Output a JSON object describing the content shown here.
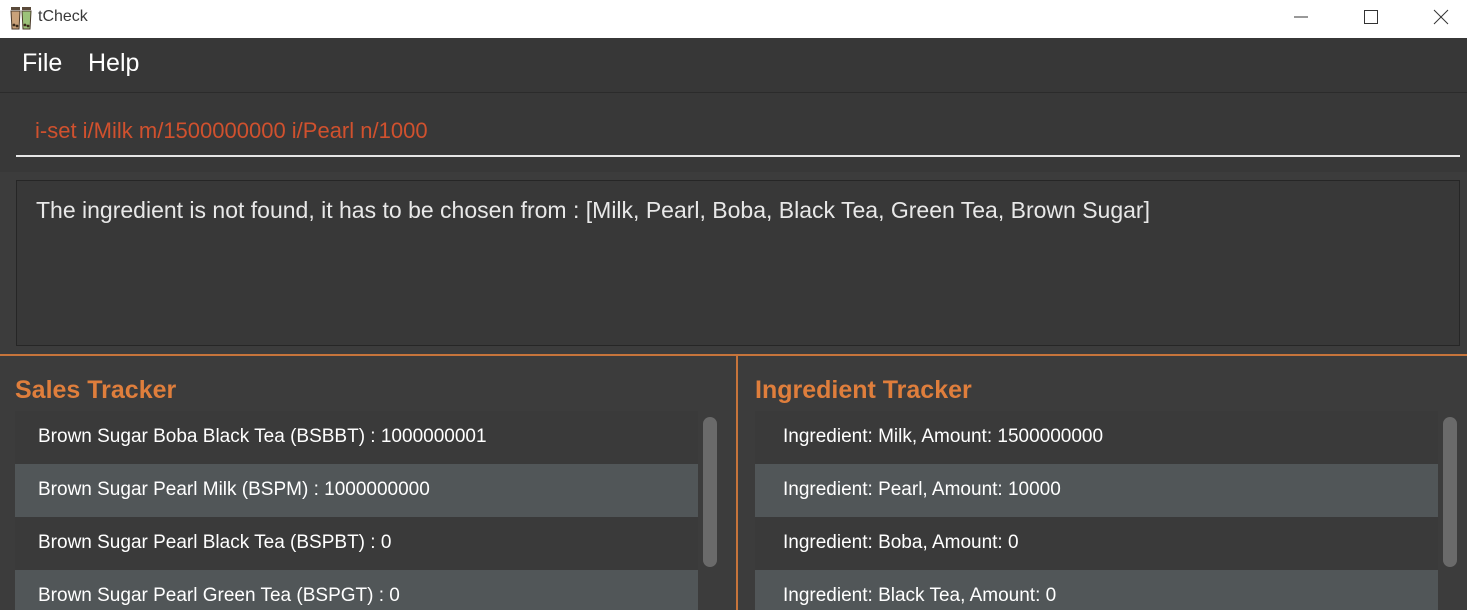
{
  "window": {
    "title": "tCheck",
    "icon": "bubble-tea-cups-icon"
  },
  "menu": {
    "file": "File",
    "help": "Help"
  },
  "command": {
    "value": "i-set i/Milk m/1500000000 i/Pearl n/1000",
    "error_color": "#d0512e"
  },
  "result": {
    "message": "The ingredient is not found, it has to be chosen from : [Milk, Pearl, Boba, Black Tea, Green Tea, Brown Sugar]"
  },
  "sales_tracker": {
    "title": "Sales Tracker",
    "items": [
      "Brown Sugar Boba Black Tea (BSBBT) : 1000000001",
      "Brown Sugar Pearl Milk (BSPM) : 1000000000",
      "Brown Sugar Pearl Black Tea (BSPBT) : 0",
      "Brown Sugar Pearl Green Tea (BSPGT) : 0"
    ]
  },
  "ingredient_tracker": {
    "title": "Ingredient Tracker",
    "items": [
      "Ingredient: Milk,  Amount: 1500000000",
      "Ingredient: Pearl,  Amount: 10000",
      "Ingredient: Boba,  Amount: 0",
      "Ingredient: Black Tea,  Amount: 0"
    ]
  },
  "colors": {
    "accent": "#df7e3c",
    "background": "#3c3c3c",
    "row_alt": "#515658"
  }
}
